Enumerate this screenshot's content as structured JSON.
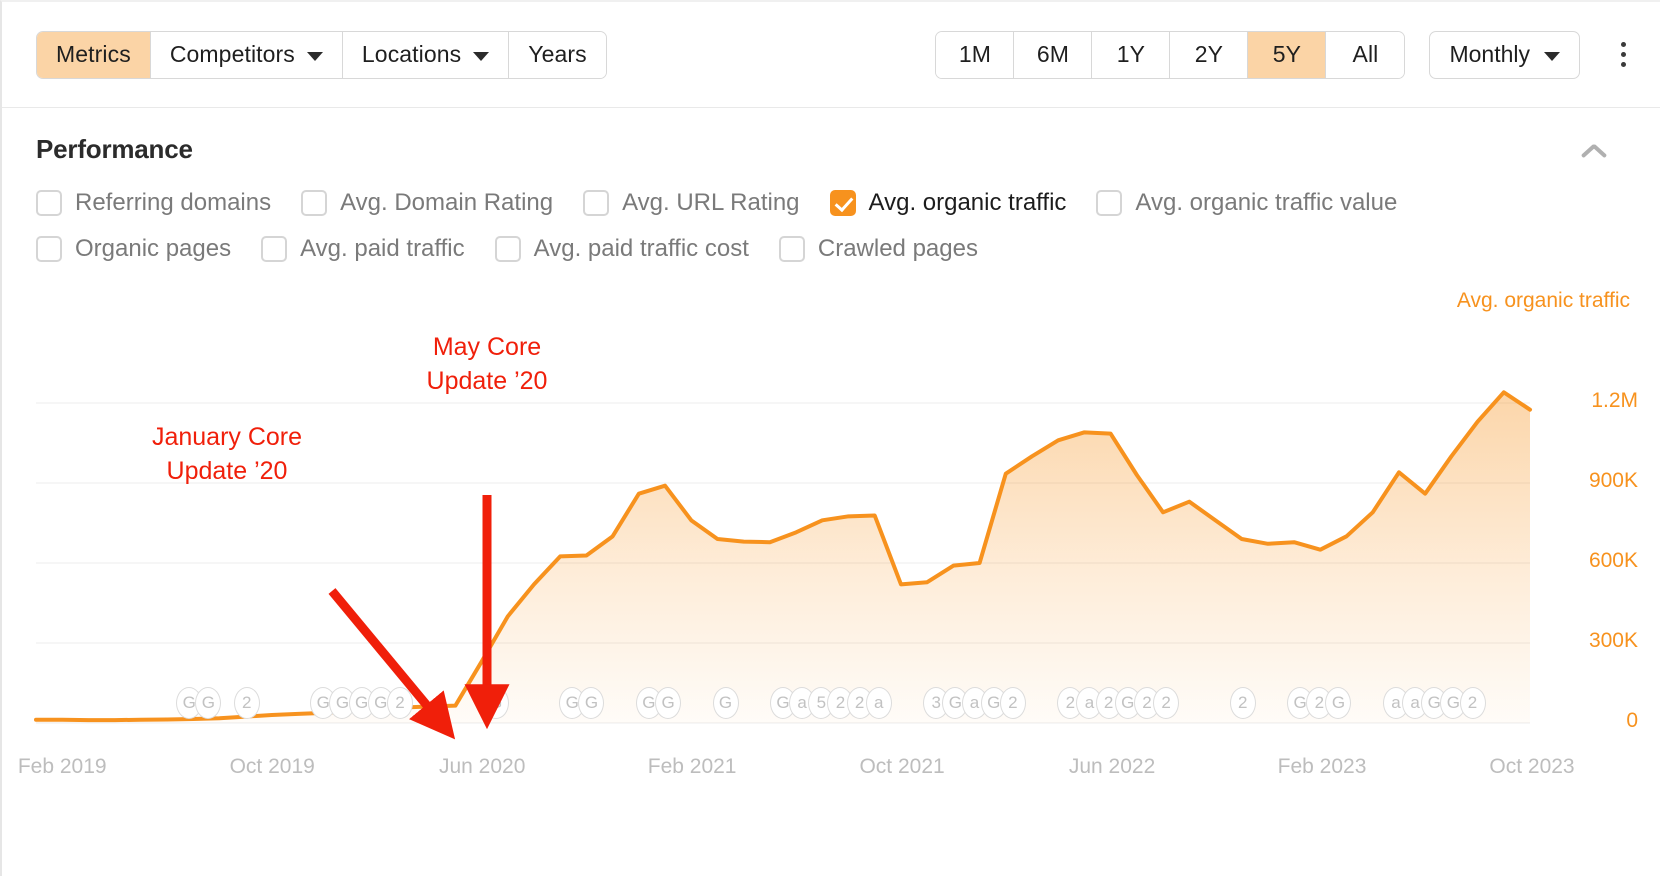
{
  "toolbar": {
    "left_group": [
      {
        "label": "Metrics",
        "active": true,
        "caret": false,
        "name": "tab-metrics"
      },
      {
        "label": "Competitors",
        "active": false,
        "caret": true,
        "name": "tab-competitors"
      },
      {
        "label": "Locations",
        "active": false,
        "caret": true,
        "name": "tab-locations"
      },
      {
        "label": "Years",
        "active": false,
        "caret": false,
        "name": "tab-years"
      }
    ],
    "range_group": [
      {
        "label": "1M",
        "active": false
      },
      {
        "label": "6M",
        "active": false
      },
      {
        "label": "1Y",
        "active": false
      },
      {
        "label": "2Y",
        "active": false
      },
      {
        "label": "5Y",
        "active": true
      },
      {
        "label": "All",
        "active": false
      }
    ],
    "granularity": "Monthly",
    "more_menu_icon": "kebab-menu-icon",
    "active_color": "#fbd4a6"
  },
  "section": {
    "title": "Performance",
    "collapse_icon": "chevron-up-icon"
  },
  "metrics": {
    "row1": [
      {
        "label": "Referring domains",
        "checked": false
      },
      {
        "label": "Avg. Domain Rating",
        "checked": false
      },
      {
        "label": "Avg. URL Rating",
        "checked": false
      },
      {
        "label": "Avg. organic traffic",
        "checked": true
      },
      {
        "label": "Avg. organic traffic value",
        "checked": false
      }
    ],
    "row2": [
      {
        "label": "Organic pages",
        "checked": false
      },
      {
        "label": "Avg. paid traffic",
        "checked": false
      },
      {
        "label": "Avg. paid traffic cost",
        "checked": false
      },
      {
        "label": "Crawled pages",
        "checked": false
      }
    ],
    "checked_color": "#f7921e"
  },
  "annotations": [
    {
      "text": "May Core\nUpdate ’20",
      "color": "#f01f0a",
      "name": "annotation-may-core-update"
    },
    {
      "text": "January Core\nUpdate ’20",
      "color": "#f01f0a",
      "name": "annotation-january-core-update"
    }
  ],
  "chart_data": {
    "type": "area",
    "title": "",
    "series_label": "Avg. organic traffic",
    "line_color": "#f7921e",
    "xlabel": "",
    "ylabel": "",
    "ylim": [
      0,
      1500000
    ],
    "yticks": [
      0,
      300000,
      600000,
      900000,
      1200000
    ],
    "ytick_labels": [
      "0",
      "300K",
      "600K",
      "900K",
      "1.2M"
    ],
    "grid": true,
    "legend_position": "top-right",
    "x_tick_labels": [
      "Feb 2019",
      "Oct 2019",
      "Jun 2020",
      "Feb 2021",
      "Oct 2021",
      "Jun 2022",
      "Feb 2023",
      "Oct 2023"
    ],
    "x_tick_index": [
      1,
      9,
      17,
      25,
      33,
      41,
      49,
      57
    ],
    "x": [
      "Jan 2019",
      "Feb 2019",
      "Mar 2019",
      "Apr 2019",
      "May 2019",
      "Jun 2019",
      "Jul 2019",
      "Aug 2019",
      "Sep 2019",
      "Oct 2019",
      "Nov 2019",
      "Dec 2019",
      "Jan 2020",
      "Feb 2020",
      "Mar 2020",
      "Apr 2020",
      "May 2020",
      "Jun 2020",
      "Jul 2020",
      "Aug 2020",
      "Sep 2020",
      "Oct 2020",
      "Nov 2020",
      "Dec 2020",
      "Jan 2021",
      "Feb 2021",
      "Mar 2021",
      "Apr 2021",
      "May 2021",
      "Jun 2021",
      "Jul 2021",
      "Aug 2021",
      "Sep 2021",
      "Oct 2021",
      "Nov 2021",
      "Dec 2021",
      "Jan 2022",
      "Feb 2022",
      "Mar 2022",
      "Apr 2022",
      "May 2022",
      "Jun 2022",
      "Jul 2022",
      "Aug 2022",
      "Sep 2022",
      "Oct 2022",
      "Nov 2022",
      "Dec 2022",
      "Jan 2023",
      "Feb 2023",
      "Mar 2023",
      "Apr 2023",
      "May 2023",
      "Jun 2023",
      "Jul 2023",
      "Aug 2023",
      "Sep 2023",
      "Oct 2023"
    ],
    "values": [
      12000,
      12000,
      11000,
      11000,
      12000,
      13000,
      15000,
      18000,
      24000,
      30000,
      34000,
      38000,
      45000,
      52000,
      58000,
      62000,
      65000,
      230000,
      400000,
      520000,
      625000,
      628000,
      700000,
      860000,
      890000,
      760000,
      690000,
      680000,
      678000,
      715000,
      760000,
      775000,
      778000,
      520000,
      528000,
      590000,
      600000,
      935000,
      1000000,
      1060000,
      1090000,
      1085000,
      930000,
      790000,
      830000,
      760000,
      690000,
      672000,
      678000,
      650000,
      700000,
      790000,
      940000,
      860000,
      1000000,
      1130000,
      1240000,
      1175000
    ]
  },
  "event_badges": [
    {
      "x_index": 8,
      "text": "G"
    },
    {
      "x_index": 9,
      "text": "G"
    },
    {
      "x_index": 11,
      "text": "2"
    },
    {
      "x_index": 15,
      "text": "G"
    },
    {
      "x_index": 16,
      "text": "G"
    },
    {
      "x_index": 17,
      "text": "G"
    },
    {
      "x_index": 18,
      "text": "G"
    },
    {
      "x_index": 19,
      "text": "2"
    },
    {
      "x_index": 24,
      "text": "G"
    },
    {
      "x_index": 28,
      "text": "G"
    },
    {
      "x_index": 29,
      "text": "G"
    },
    {
      "x_index": 32,
      "text": "G"
    },
    {
      "x_index": 33,
      "text": "G"
    },
    {
      "x_index": 36,
      "text": "G"
    },
    {
      "x_index": 39,
      "text": "G"
    },
    {
      "x_index": 40,
      "text": "a"
    },
    {
      "x_index": 41,
      "text": "5"
    },
    {
      "x_index": 42,
      "text": "2"
    },
    {
      "x_index": 43,
      "text": "2"
    },
    {
      "x_index": 44,
      "text": "a"
    },
    {
      "x_index": 47,
      "text": "3"
    },
    {
      "x_index": 48,
      "text": "G"
    },
    {
      "x_index": 49,
      "text": "a"
    },
    {
      "x_index": 50,
      "text": "G"
    },
    {
      "x_index": 51,
      "text": "2"
    },
    {
      "x_index": 54,
      "text": "2"
    },
    {
      "x_index": 55,
      "text": "a"
    },
    {
      "x_index": 56,
      "text": "2"
    },
    {
      "x_index": 57,
      "text": "G"
    },
    {
      "x_index": 58,
      "text": "2"
    },
    {
      "x_index": 59,
      "text": "2"
    },
    {
      "x_index": 63,
      "text": "2"
    },
    {
      "x_index": 66,
      "text": "G"
    },
    {
      "x_index": 67,
      "text": "2"
    },
    {
      "x_index": 68,
      "text": "G"
    },
    {
      "x_index": 71,
      "text": "a"
    },
    {
      "x_index": 72,
      "text": "a"
    },
    {
      "x_index": 73,
      "text": "G"
    },
    {
      "x_index": 74,
      "text": "G"
    },
    {
      "x_index": 75,
      "text": "2"
    }
  ]
}
